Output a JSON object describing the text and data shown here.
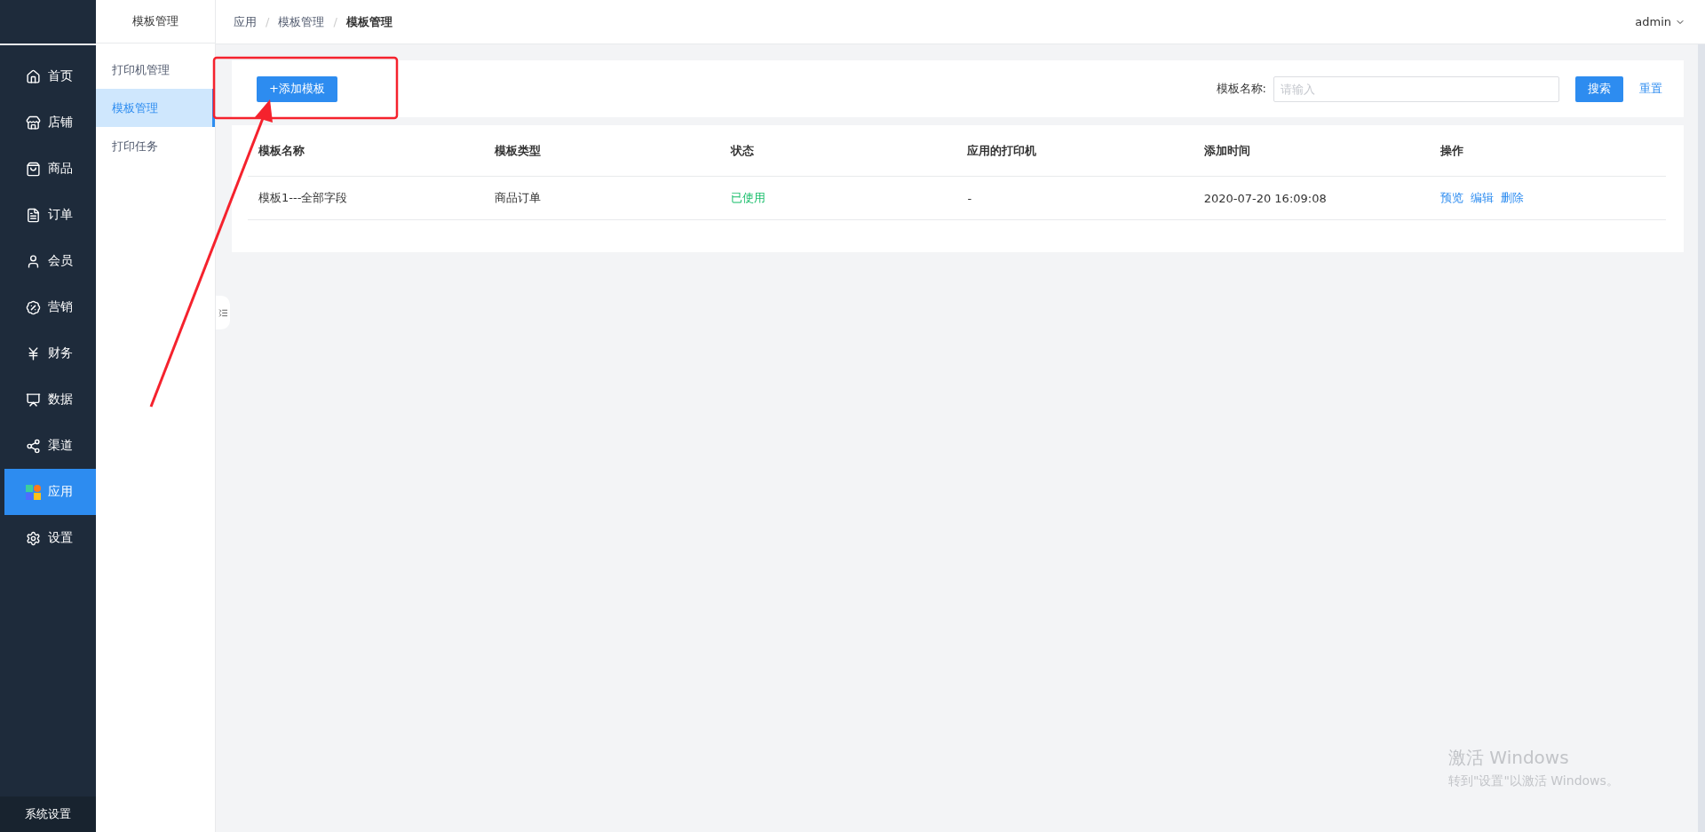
{
  "sidebar": {
    "items": [
      {
        "label": "首页",
        "selected": false
      },
      {
        "label": "店铺",
        "selected": false
      },
      {
        "label": "商品",
        "selected": false
      },
      {
        "label": "订单",
        "selected": false
      },
      {
        "label": "会员",
        "selected": false
      },
      {
        "label": "营销",
        "selected": false
      },
      {
        "label": "财务",
        "selected": false
      },
      {
        "label": "数据",
        "selected": false
      },
      {
        "label": "渠道",
        "selected": false
      },
      {
        "label": "应用",
        "selected": true
      },
      {
        "label": "设置",
        "selected": false
      }
    ],
    "footer": "系统设置"
  },
  "submenu": {
    "title": "模板管理",
    "items": [
      {
        "label": "打印机管理",
        "selected": false
      },
      {
        "label": "模板管理",
        "selected": true
      },
      {
        "label": "打印任务",
        "selected": false
      }
    ]
  },
  "breadcrumb": [
    "应用",
    "/",
    "模板管理",
    "/",
    "模板管理"
  ],
  "user": "admin",
  "toolbar": {
    "add_button": "+添加模板",
    "filter_label": "模板名称:",
    "placeholder": "请输入",
    "search_button": "搜索",
    "reset_link": "重置"
  },
  "table": {
    "columns": [
      "模板名称",
      "模板类型",
      "状态",
      "应用的打印机",
      "添加时间",
      "操作"
    ],
    "rows": [
      {
        "name": "模板1---全部字段",
        "type": "商品订单",
        "status": "已使用",
        "printer": "-",
        "added": "2020-07-20 16:09:08",
        "actions": [
          "预览",
          "编辑",
          "删除"
        ]
      }
    ]
  },
  "os_notice": {
    "title": "激活 Windows",
    "text": "转到\"设置\"以激活 Windows。"
  }
}
